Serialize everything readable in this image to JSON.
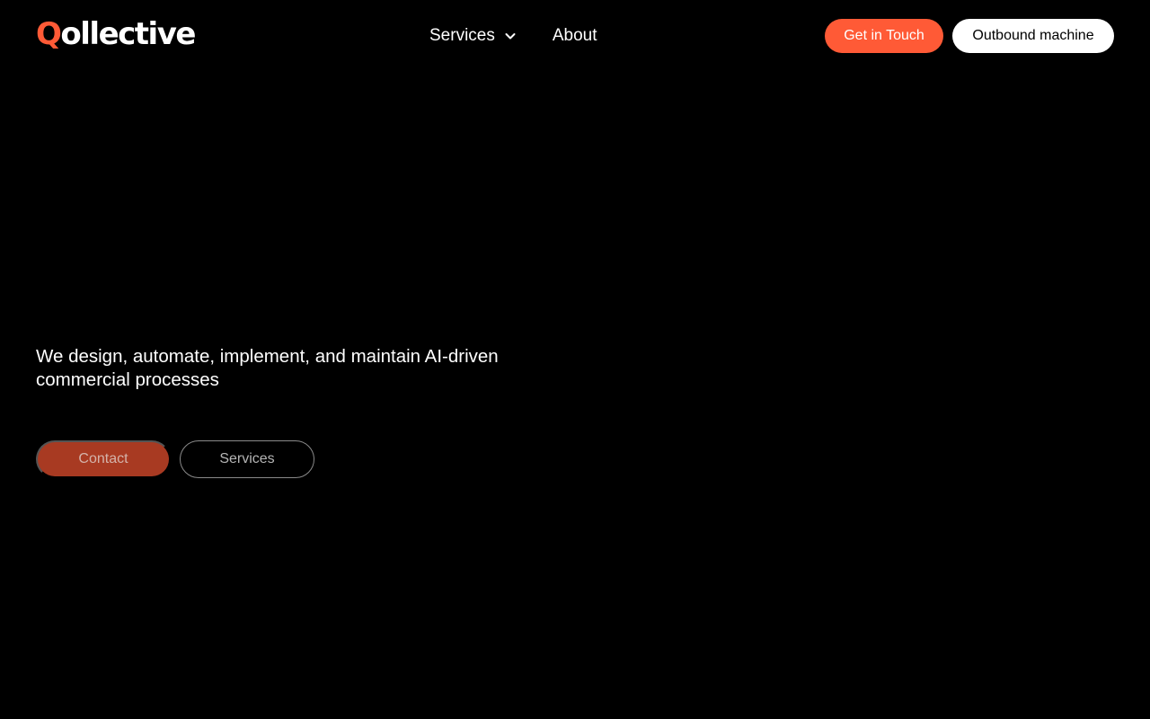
{
  "brand": {
    "logo_first": "Q",
    "logo_rest": "ollective",
    "accent_color": "#ff5a36"
  },
  "nav": {
    "services_label": "Services",
    "services_icon": "chevron-down-icon",
    "about_label": "About"
  },
  "header_actions": {
    "get_in_touch": "Get in Touch",
    "outbound_machine": "Outbound machine"
  },
  "hero": {
    "tagline": "We design, automate, implement, and maintain AI-driven commercial processes",
    "contact_label": "Contact",
    "services_label": "Services"
  }
}
